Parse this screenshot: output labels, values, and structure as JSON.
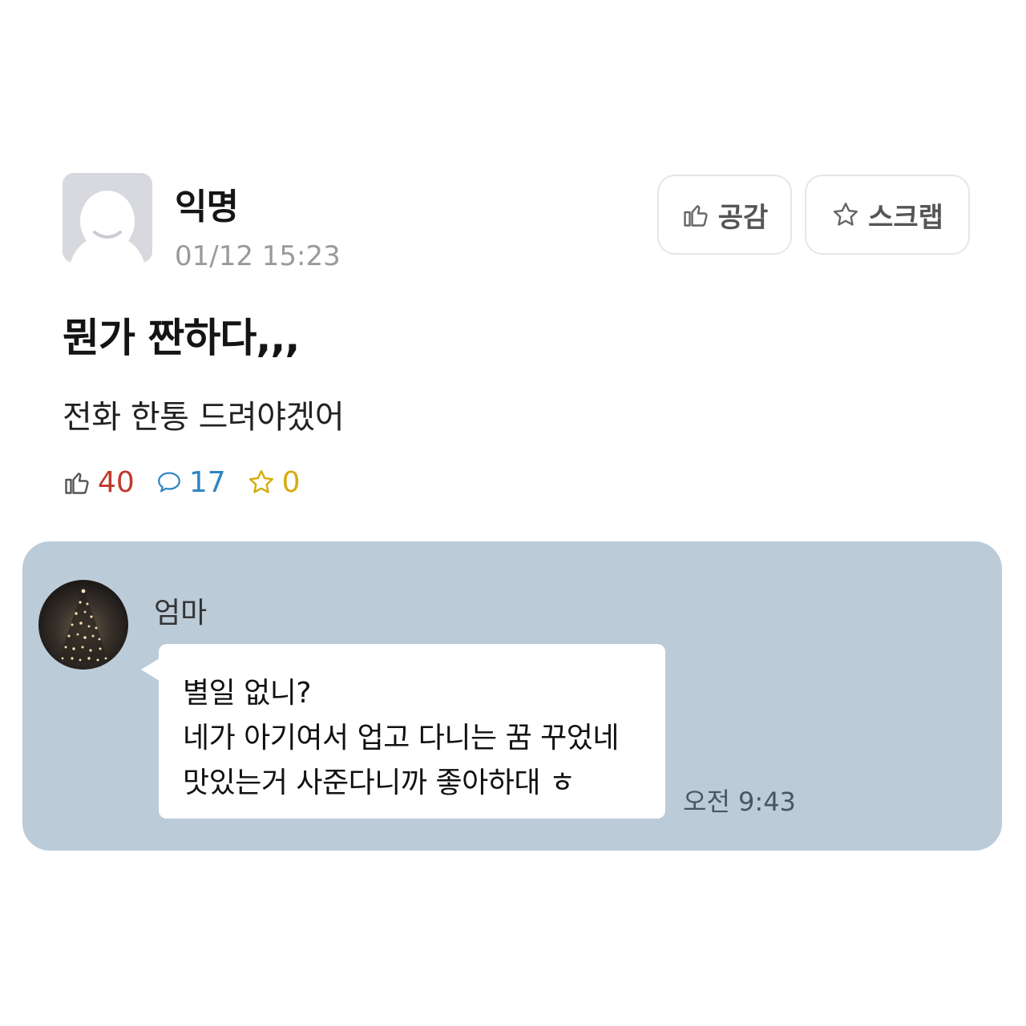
{
  "post": {
    "author": "익명",
    "timestamp": "01/12 15:23",
    "title": "뭔가 짠하다,,,",
    "body": "전화 한통 드려야겠어",
    "actions": {
      "like_label": "공감",
      "scrap_label": "스크랩"
    },
    "stats": {
      "likes": "40",
      "comments": "17",
      "scraps": "0"
    }
  },
  "chat": {
    "sender": "엄마",
    "message_lines": [
      "별일 없니?",
      "네가 아기여서 업고 다니는 꿈 꾸었네",
      "맛있는거 사준다니까 좋아하대 ㅎ"
    ],
    "time": "오전 9:43"
  },
  "icons": {
    "like": "thumbs-up-icon",
    "comment": "speech-bubble-icon",
    "scrap": "star-icon"
  },
  "colors": {
    "like_stat": "#c0392b",
    "comment_stat": "#2e86c1",
    "scrap_stat": "#d4ac0d",
    "chat_background": "#bccbd8"
  }
}
